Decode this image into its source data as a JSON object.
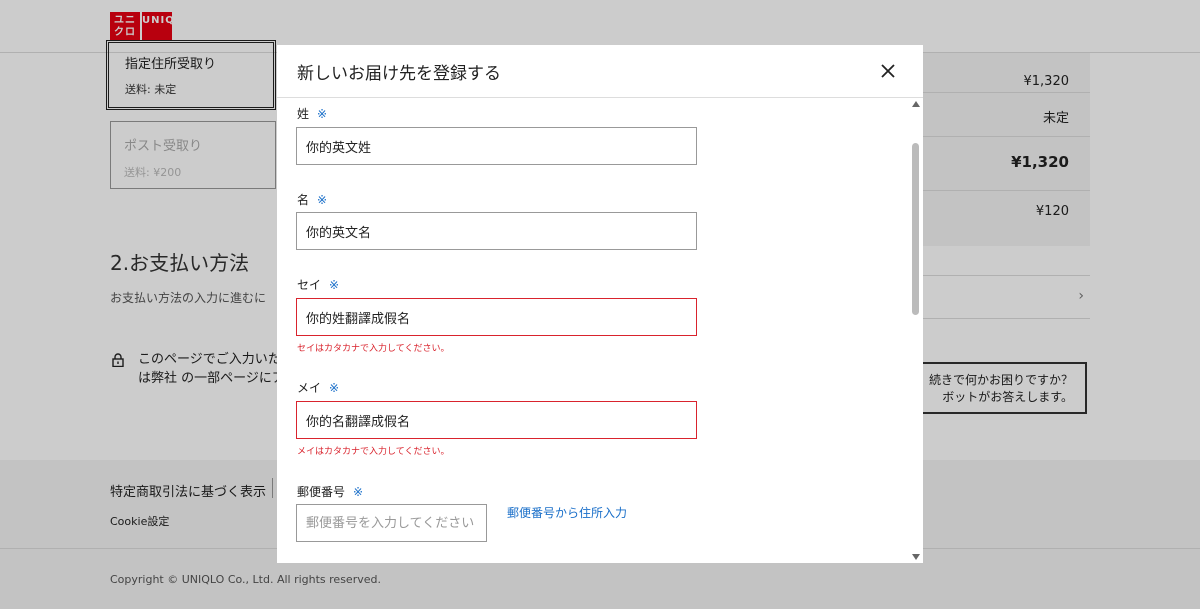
{
  "background": {
    "logo": {
      "left_text": "ユニクロ",
      "right_text": "UNIQLO"
    },
    "shipping": {
      "selected": {
        "title": "指定住所受取り",
        "fee": "送料: 未定"
      },
      "post": {
        "title": "ポスト受取り",
        "fee": "送料: ¥200"
      }
    },
    "payment": {
      "title": "2.お支払い方法",
      "desc": "お支払い方法の入力に進むに"
    },
    "security": {
      "line1": "このページでご入力いた",
      "line2": "は弊社 の一部ページにア"
    },
    "summary": {
      "subtotal": "¥1,320",
      "shipping": "未定",
      "total": "¥1,320",
      "tax": "¥120"
    },
    "help": {
      "line1": "続きで何かお困りですか？",
      "line2": "ボットがお答えします。"
    },
    "footer": {
      "legal": "特定商取引法に基づく表示",
      "cookie": "Cookie設定",
      "copyright": "Copyright © UNIQLO Co., Ltd. All rights reserved."
    }
  },
  "modal": {
    "title": "新しいお届け先を登録する",
    "required_mark": "※",
    "fields": {
      "last_name": {
        "label": "姓",
        "value": "你的英文姓"
      },
      "first_name": {
        "label": "名",
        "value": "你的英文名"
      },
      "last_kana": {
        "label": "セイ",
        "value": "你的姓翻譯成假名",
        "error": "セイはカタカナで入力してください。"
      },
      "first_kana": {
        "label": "メイ",
        "value": "你的名翻譯成假名",
        "error": "メイはカタカナで入力してください。"
      },
      "postal": {
        "label": "郵便番号",
        "placeholder": "郵便番号を入力してください",
        "link": "郵便番号から住所入力"
      }
    }
  },
  "colors": {
    "brand": "#e60012",
    "error": "#d9232d",
    "link": "#1a6fc9"
  }
}
